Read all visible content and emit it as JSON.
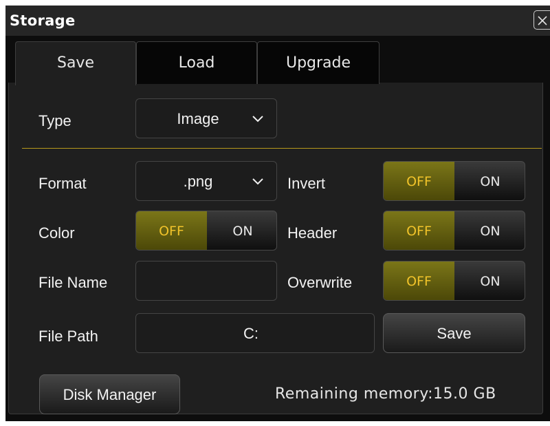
{
  "dialog": {
    "title": "Storage"
  },
  "tabs": [
    {
      "label": "Save",
      "active": true
    },
    {
      "label": "Load",
      "active": false
    },
    {
      "label": "Upgrade",
      "active": false
    }
  ],
  "form": {
    "type": {
      "label": "Type",
      "value": "Image"
    },
    "format": {
      "label": "Format",
      "value": ".png"
    },
    "color": {
      "label": "Color",
      "off": "OFF",
      "on": "ON",
      "state": "OFF"
    },
    "invert": {
      "label": "Invert",
      "off": "OFF",
      "on": "ON",
      "state": "OFF"
    },
    "header": {
      "label": "Header",
      "off": "OFF",
      "on": "ON",
      "state": "OFF"
    },
    "overwrite": {
      "label": "Overwrite",
      "off": "OFF",
      "on": "ON",
      "state": "OFF"
    },
    "file_name": {
      "label": "File Name",
      "value": ""
    },
    "file_path": {
      "label": "File Path",
      "value": "C:"
    }
  },
  "buttons": {
    "save": "Save",
    "disk_manager": "Disk Manager"
  },
  "status": {
    "remaining": "Remaining memory:15.0 GB"
  },
  "colors": {
    "accent_on": "#f1c32a",
    "separator": "#b89a1c"
  }
}
